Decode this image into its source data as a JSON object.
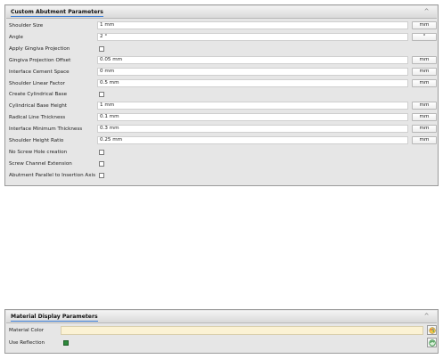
{
  "abutment_panel": {
    "title": "Custom Abutment Parameters",
    "collapse_glyph": "^",
    "rows": [
      {
        "label": "Shoulder Size",
        "value": "1 mm",
        "unit": "mm"
      },
      {
        "label": "Angle",
        "value": "2 °",
        "unit": "°"
      },
      {
        "label": "Apply Gingiva Projection",
        "checked": false
      },
      {
        "label": "Gingiva Projection Offset",
        "value": "0.05 mm",
        "unit": "mm"
      },
      {
        "label": "Interface Cement Space",
        "value": "0 mm",
        "unit": "mm"
      },
      {
        "label": "Shoulder Linear Factor",
        "value": "0.5 mm",
        "unit": "mm"
      },
      {
        "label": "Create Cylindrical Base",
        "checked": false
      },
      {
        "label": "Cylindrical Base Height",
        "value": "1 mm",
        "unit": "mm"
      },
      {
        "label": "Radical Line Thickness",
        "value": "0.1 mm",
        "unit": "mm"
      },
      {
        "label": "Interface Minimum Thickness",
        "value": "0.3 mm",
        "unit": "mm"
      },
      {
        "label": "Shoulder Height Ratio",
        "value": "0.25 mm",
        "unit": "mm"
      },
      {
        "label": "No Screw Hole creation",
        "checked": false
      },
      {
        "label": "Screw Channel Extension",
        "checked": false
      },
      {
        "label": "Abutment Parallel to Insertion Axis",
        "checked": false
      }
    ]
  },
  "material_panel": {
    "title": "Material Display Parameters",
    "collapse_glyph": "^",
    "material_color_label": "Material Color",
    "material_color_value": "#fbf2d4",
    "use_reflection_label": "Use Reflection",
    "use_reflection_checked": true,
    "color_picker_icon": "palette-icon",
    "reflection_icon": "refresh-icon"
  }
}
